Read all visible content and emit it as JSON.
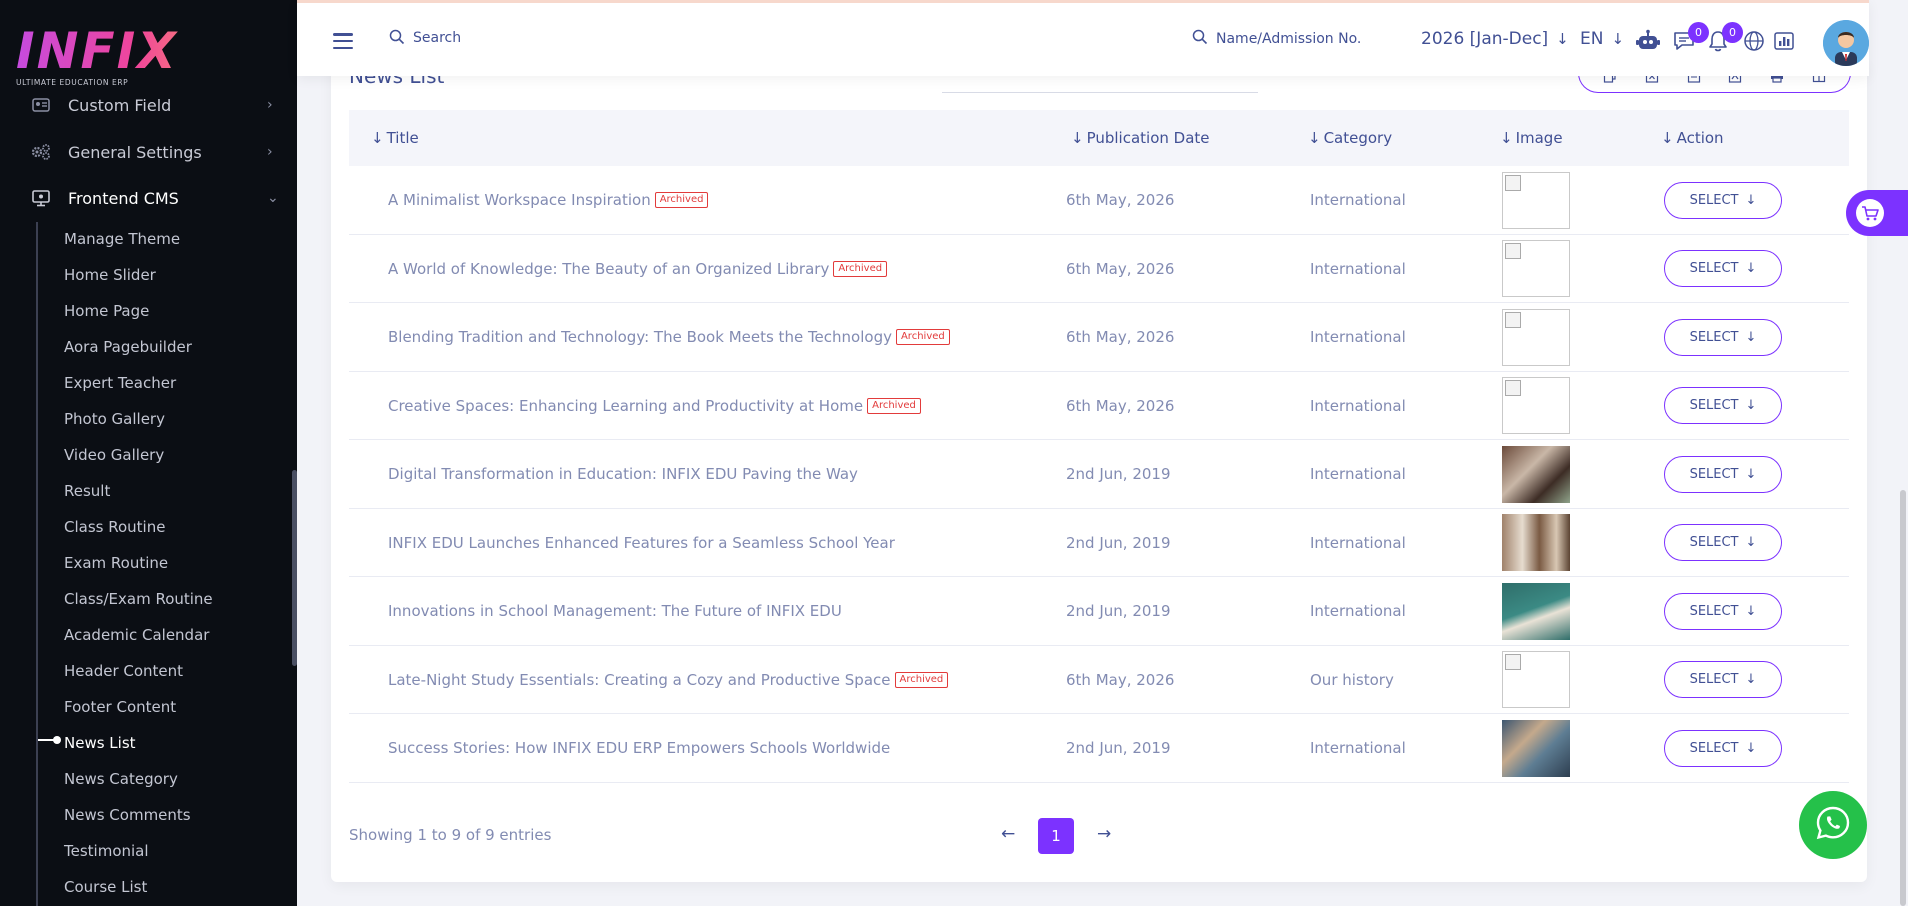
{
  "brand": {
    "logo_text": "INFIX",
    "tagline": "ULTIMATE EDUCATION ERP",
    "accent": "#7c32ff"
  },
  "sidebar": {
    "menu": [
      {
        "label": "Custom Field",
        "icon": "id-card-icon"
      },
      {
        "label": "General Settings",
        "icon": "gears-icon"
      },
      {
        "label": "Frontend CMS",
        "icon": "monitor-icon"
      }
    ],
    "submenu": [
      "Manage Theme",
      "Home Slider",
      "Home Page",
      "Aora Pagebuilder",
      "Expert Teacher",
      "Photo Gallery",
      "Video Gallery",
      "Result",
      "Class Routine",
      "Exam Routine",
      "Class/Exam Routine",
      "Academic Calendar",
      "Header Content",
      "Footer Content",
      "News List",
      "News Category",
      "News Comments",
      "Testimonial",
      "Course List"
    ],
    "active_item": "News List"
  },
  "topbar": {
    "search_label": "Search",
    "name_search_label": "Name/Admission No.",
    "year": "2026 [Jan-Dec]",
    "language": "EN",
    "chat_count": "0",
    "notification_count": "0"
  },
  "page": {
    "title": "News List"
  },
  "table": {
    "headers": [
      "Title",
      "Publication Date",
      "Category",
      "Image",
      "Action"
    ],
    "archived_label": "Archived",
    "select_label": "SELECT",
    "rows": [
      {
        "title": "A Minimalist Workspace Inspiration",
        "archived": true,
        "date": "6th May, 2026",
        "category": "International",
        "image": "broken"
      },
      {
        "title": "A World of Knowledge: The Beauty of an Organized Library",
        "archived": true,
        "date": "6th May, 2026",
        "category": "International",
        "image": "broken"
      },
      {
        "title": "Blending Tradition and Technology: The Book Meets the Technology",
        "archived": true,
        "date": "6th May, 2026",
        "category": "International",
        "image": "broken"
      },
      {
        "title": "Creative Spaces: Enhancing Learning and Productivity at Home",
        "archived": true,
        "date": "6th May, 2026",
        "category": "International",
        "image": "broken"
      },
      {
        "title": "Digital Transformation in Education: INFIX EDU Paving the Way",
        "archived": false,
        "date": "2nd Jun, 2019",
        "category": "International",
        "image": "photo-1"
      },
      {
        "title": "INFIX EDU Launches Enhanced Features for a Seamless School Year",
        "archived": false,
        "date": "2nd Jun, 2019",
        "category": "International",
        "image": "photo-2"
      },
      {
        "title": "Innovations in School Management: The Future of INFIX EDU",
        "archived": false,
        "date": "2nd Jun, 2019",
        "category": "International",
        "image": "photo-3"
      },
      {
        "title": "Late-Night Study Essentials: Creating a Cozy and Productive Space",
        "archived": true,
        "date": "6th May, 2026",
        "category": "Our history",
        "image": "broken"
      },
      {
        "title": "Success Stories: How INFIX EDU ERP Empowers Schools Worldwide",
        "archived": false,
        "date": "2nd Jun, 2019",
        "category": "International",
        "image": "photo-4"
      }
    ]
  },
  "pagination": {
    "summary": "Showing 1 to 9 of 9 entries",
    "current_page": "1"
  }
}
